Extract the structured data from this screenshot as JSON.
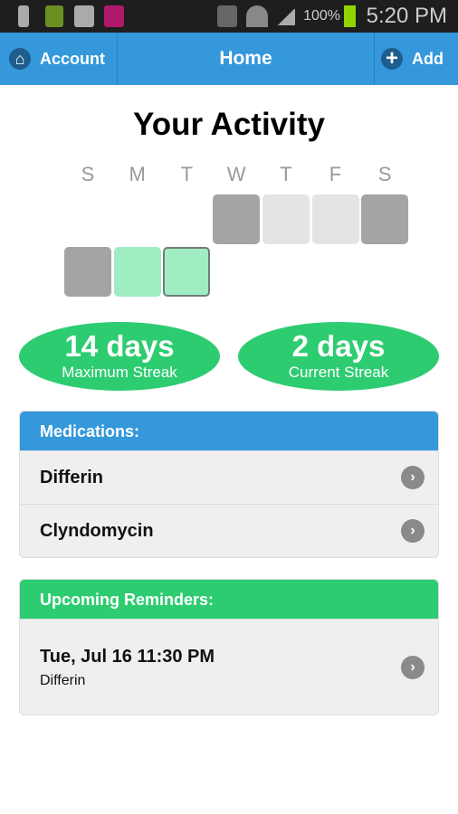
{
  "status_bar": {
    "battery_pct": "100%",
    "time": "5:20 PM",
    "icons": [
      "usb-icon",
      "battery-icon",
      "messenger-icon",
      "tmobile-icon",
      "mute-icon",
      "wifi-icon",
      "signal-icon"
    ]
  },
  "nav": {
    "left_label": "Account",
    "left_icon": "home-icon",
    "title": "Home",
    "right_label": "Add",
    "right_icon": "plus-icon"
  },
  "activity": {
    "title": "Your Activity",
    "days": [
      "S",
      "M",
      "T",
      "W",
      "T",
      "F",
      "S"
    ],
    "cells": [
      {
        "row": 0,
        "col": 3,
        "state": "missed"
      },
      {
        "row": 0,
        "col": 4,
        "state": "empty"
      },
      {
        "row": 0,
        "col": 5,
        "state": "empty"
      },
      {
        "row": 0,
        "col": 6,
        "state": "missed"
      },
      {
        "row": 1,
        "col": 0,
        "state": "missed"
      },
      {
        "row": 1,
        "col": 1,
        "state": "done"
      },
      {
        "row": 1,
        "col": 2,
        "state": "done-today"
      }
    ],
    "colors": {
      "missed": "#a5a3a6",
      "empty": "#e4e3e6",
      "done": "#a0ecc3"
    }
  },
  "streaks": [
    {
      "value": "14 days",
      "label": "Maximum Streak"
    },
    {
      "value": "2 days",
      "label": "Current Streak"
    }
  ],
  "medications": {
    "header": "Medications:",
    "color": "#3498db",
    "items": [
      "Differin",
      "Clyndomycin"
    ]
  },
  "reminders": {
    "header": "Upcoming Reminders:",
    "color": "#2ecc71",
    "items": [
      {
        "when": "Tue, Jul 16 11:30 PM",
        "med": "Differin"
      }
    ]
  }
}
